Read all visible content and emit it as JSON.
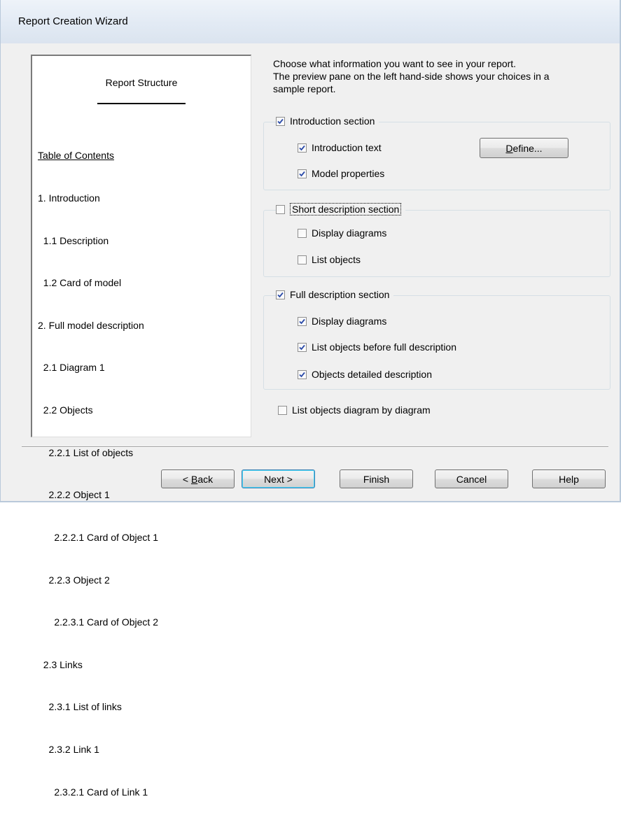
{
  "window": {
    "title": "Report Creation Wizard"
  },
  "preview": {
    "heading": "Report Structure",
    "toc_title": "Table of Contents",
    "toc_items": [
      "1. Introduction",
      "  1.1 Description",
      "  1.2 Card of model",
      "2. Full model description",
      "  2.1 Diagram 1",
      "  2.2 Objects",
      "    2.2.1 List of objects",
      "    2.2.2 Object 1",
      "      2.2.2.1 Card of Object 1",
      "    2.2.3 Object 2",
      "      2.2.3.1 Card of Object 2",
      "  2.3 Links",
      "    2.3.1 List of links",
      "    2.3.2 Link 1",
      "      2.3.2.1 Card of Link 1"
    ]
  },
  "instructions": {
    "line1": "Choose what information you want to see in your report.",
    "line2": "The preview pane on the left hand-side shows your choices in a",
    "line3": "sample report."
  },
  "intro": {
    "label": "Introduction section",
    "checked": true,
    "text_label": "Introduction text",
    "text_checked": true,
    "props_label": "Model properties",
    "props_checked": true,
    "define_underlined": "D",
    "define_rest": "efine..."
  },
  "short": {
    "label": "Short description section",
    "checked": false,
    "diagrams_label": "Display diagrams",
    "diagrams_checked": false,
    "objects_label": "List objects",
    "objects_checked": false
  },
  "full": {
    "label": "Full description section",
    "checked": true,
    "diagrams_label": "Display diagrams",
    "diagrams_checked": true,
    "objects_label": "List objects before full description",
    "objects_checked": true,
    "detailed_label": "Objects detailed description",
    "detailed_checked": true
  },
  "bydiagram": {
    "label": "List objects diagram by diagram",
    "checked": false
  },
  "buttons": {
    "back_prefix": "< ",
    "back_underlined": "B",
    "back_rest": "ack",
    "next": "Next >",
    "finish": "Finish",
    "cancel": "Cancel",
    "help": "Help"
  }
}
